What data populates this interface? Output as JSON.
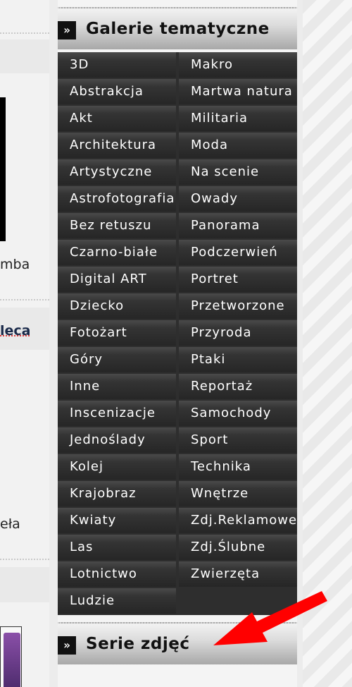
{
  "left_fragments": {
    "frag1": "mba",
    "frag2": "leca",
    "frag3": "eła"
  },
  "sidebar": {
    "gallery_title": "Galerie tematyczne",
    "series_title": "Serie zdjęć",
    "header_icon": "»",
    "categories_col1": [
      "3D",
      "Abstrakcja",
      "Akt",
      "Architektura",
      "Artystyczne",
      "Astrofotografia",
      "Bez retuszu",
      "Czarno-białe",
      "Digital ART",
      "Dziecko",
      "Fotożart",
      "Góry",
      "Inne",
      "Inscenizacje",
      "Jednoślady",
      "Kolej",
      "Krajobraz",
      "Kwiaty",
      "Las",
      "Lotnictwo",
      "Ludzie"
    ],
    "categories_col2": [
      "Makro",
      "Martwa natura",
      "Militaria",
      "Moda",
      "Na scenie",
      "Owady",
      "Panorama",
      "Podczerwień",
      "Portret",
      "Przetworzone",
      "Przyroda",
      "Ptaki",
      "Reportaż",
      "Samochody",
      "Sport",
      "Technika",
      "Wnętrze",
      "Zdj.Reklamowe",
      "Zdj.Ślubne",
      "Zwierzęta"
    ]
  },
  "colors": {
    "menu_bg": "#2e2e2e",
    "arrow": "#ff0000"
  }
}
